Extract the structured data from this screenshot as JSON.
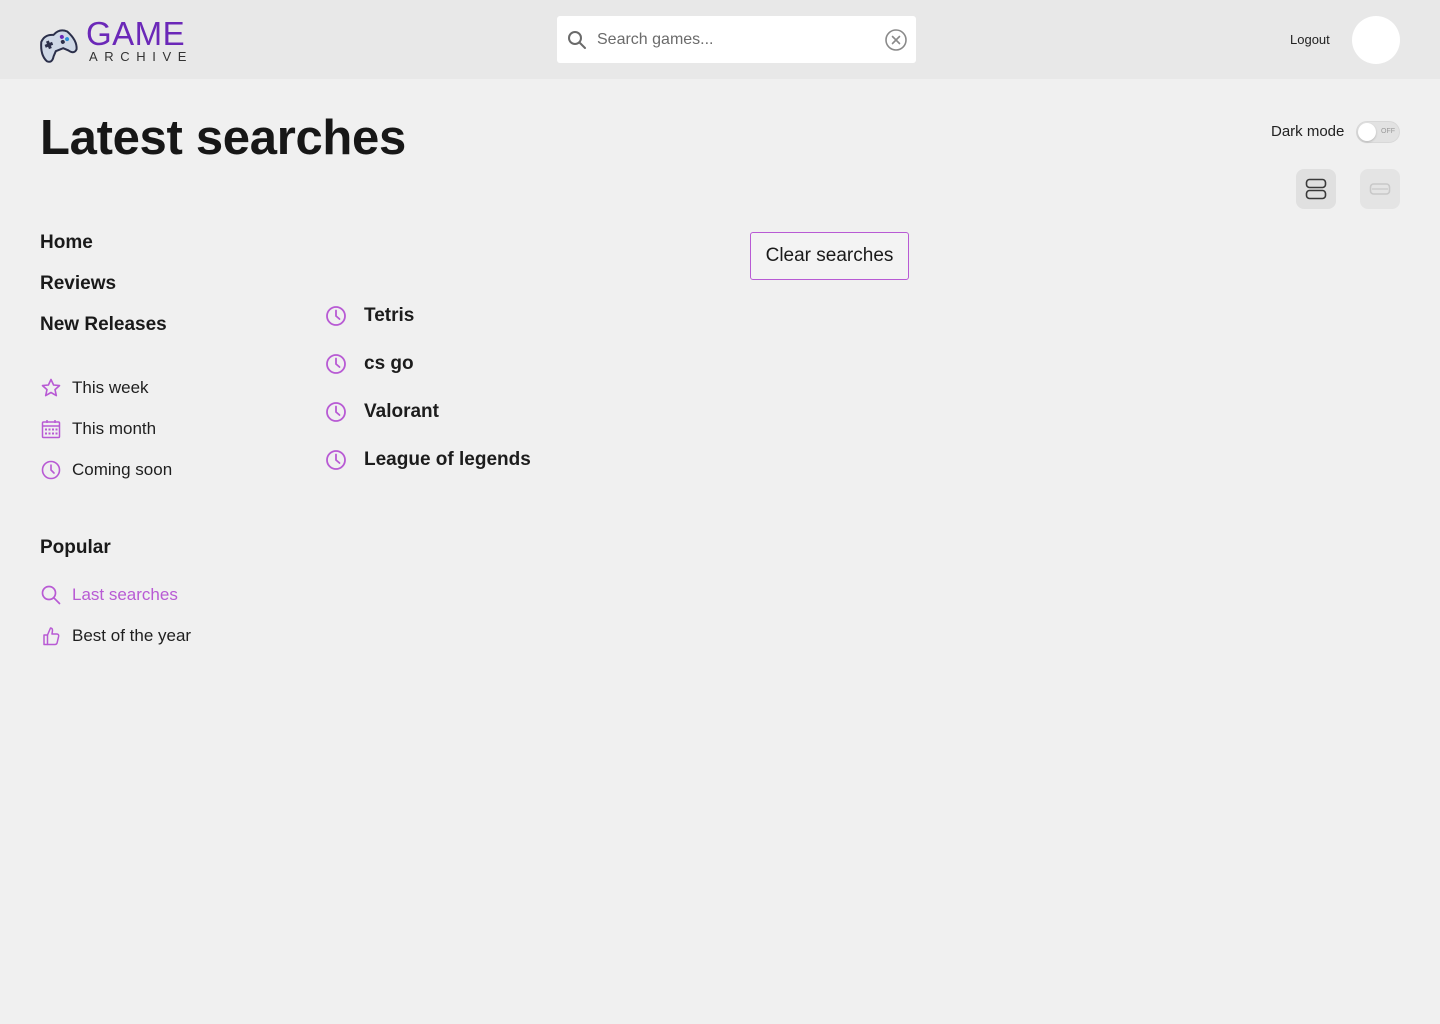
{
  "brand": {
    "name_top": "GAME",
    "name_bottom": "ARCHIVE",
    "icon": "gamepad-icon",
    "color": "#6b28b8"
  },
  "header": {
    "search": {
      "placeholder": "Search games...",
      "value": ""
    },
    "logout_label": "Logout"
  },
  "page": {
    "title": "Latest searches"
  },
  "settings": {
    "dark_mode_label": "Dark mode",
    "dark_mode_state": "OFF"
  },
  "view_toggles": [
    {
      "icon": "list-view-icon"
    },
    {
      "icon": "single-view-icon"
    }
  ],
  "sidebar": {
    "nav": [
      {
        "label": "Home"
      },
      {
        "label": "Reviews"
      },
      {
        "label": "New Releases"
      }
    ],
    "new_releases_items": [
      {
        "label": "This week",
        "icon": "star-icon"
      },
      {
        "label": "This month",
        "icon": "calendar-icon"
      },
      {
        "label": "Coming soon",
        "icon": "clock-icon"
      }
    ],
    "popular_title": "Popular",
    "popular_items": [
      {
        "label": "Last searches",
        "icon": "search-icon",
        "active": true
      },
      {
        "label": "Best of the year",
        "icon": "thumbs-up-icon",
        "active": false
      }
    ]
  },
  "searches": {
    "clear_label": "Clear searches",
    "items": [
      {
        "label": "Tetris",
        "icon": "clock-icon"
      },
      {
        "label": "cs go",
        "icon": "clock-icon"
      },
      {
        "label": "Valorant",
        "icon": "clock-icon"
      },
      {
        "label": "League of legends",
        "icon": "clock-icon"
      }
    ]
  },
  "colors": {
    "accent": "#b85ad4",
    "background": "#f0f0f0",
    "header_bg": "#e8e8e8"
  }
}
